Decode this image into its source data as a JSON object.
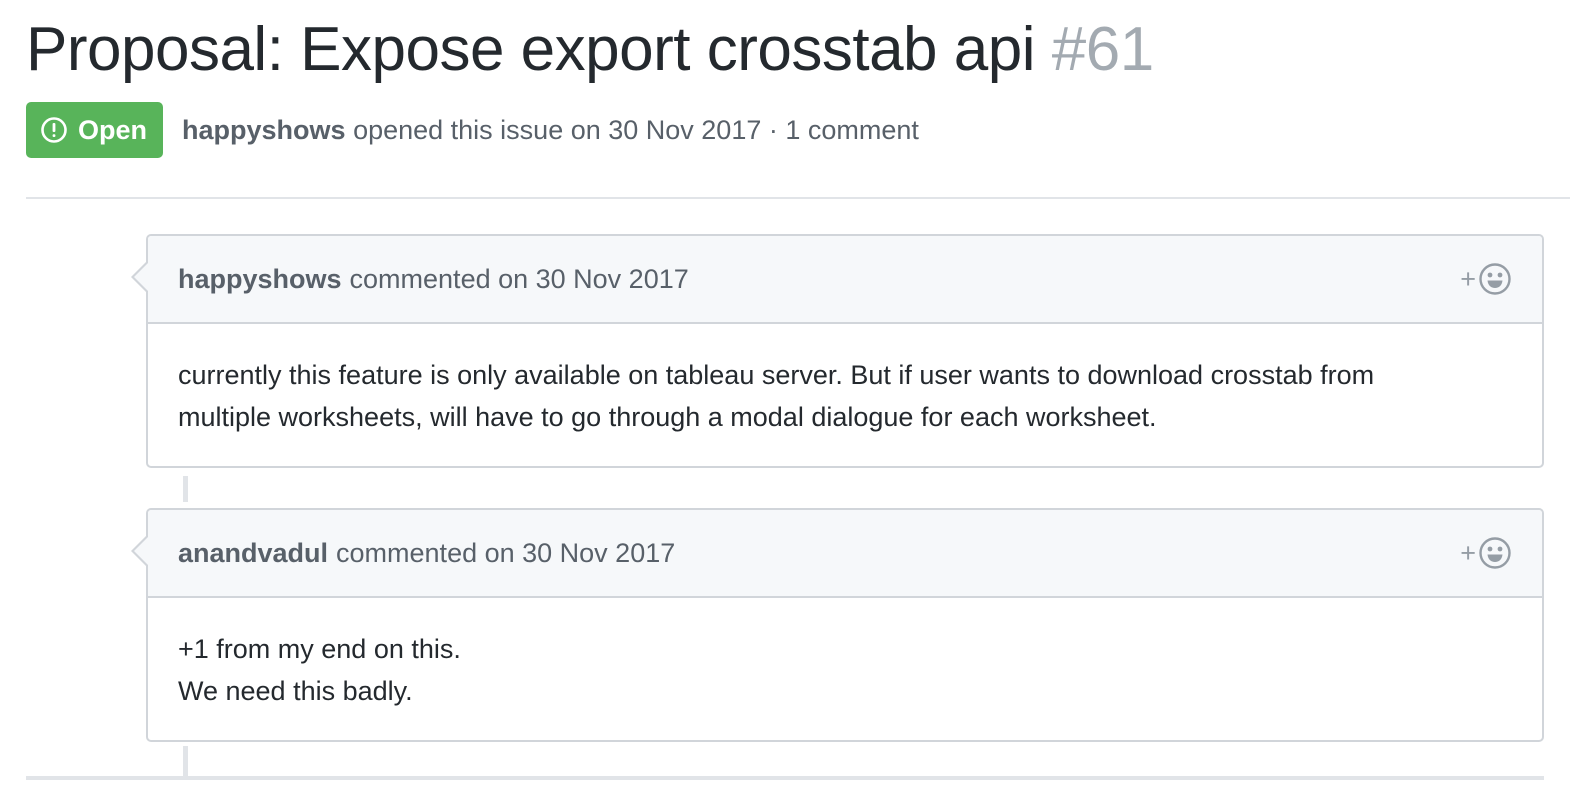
{
  "issue": {
    "title": "Proposal: Expose export crosstab api",
    "number": "#61",
    "state": "Open",
    "author": "happyshows",
    "opened_text": "opened this issue on 30 Nov 2017 · 1 comment"
  },
  "comments": [
    {
      "author": "happyshows",
      "action": "commented on 30 Nov 2017",
      "reaction_label": "+",
      "body": [
        "currently this feature is only available on tableau server. But if user wants to download crosstab from",
        "multiple worksheets, will have to go through a modal dialogue for each worksheet."
      ]
    },
    {
      "author": "anandvadul",
      "action": "commented on 30 Nov 2017",
      "reaction_label": "+",
      "body": [
        "+1 from my end on this.",
        "We need this badly."
      ]
    }
  ],
  "colors": {
    "open_badge": "#58b45a",
    "header_bg": "#f6f8fa",
    "border": "#d1d5da",
    "muted_text": "#586069",
    "number_text": "#a3aab1"
  },
  "icons": {
    "state": "issue-opened-icon",
    "reaction": "smiley-icon"
  }
}
